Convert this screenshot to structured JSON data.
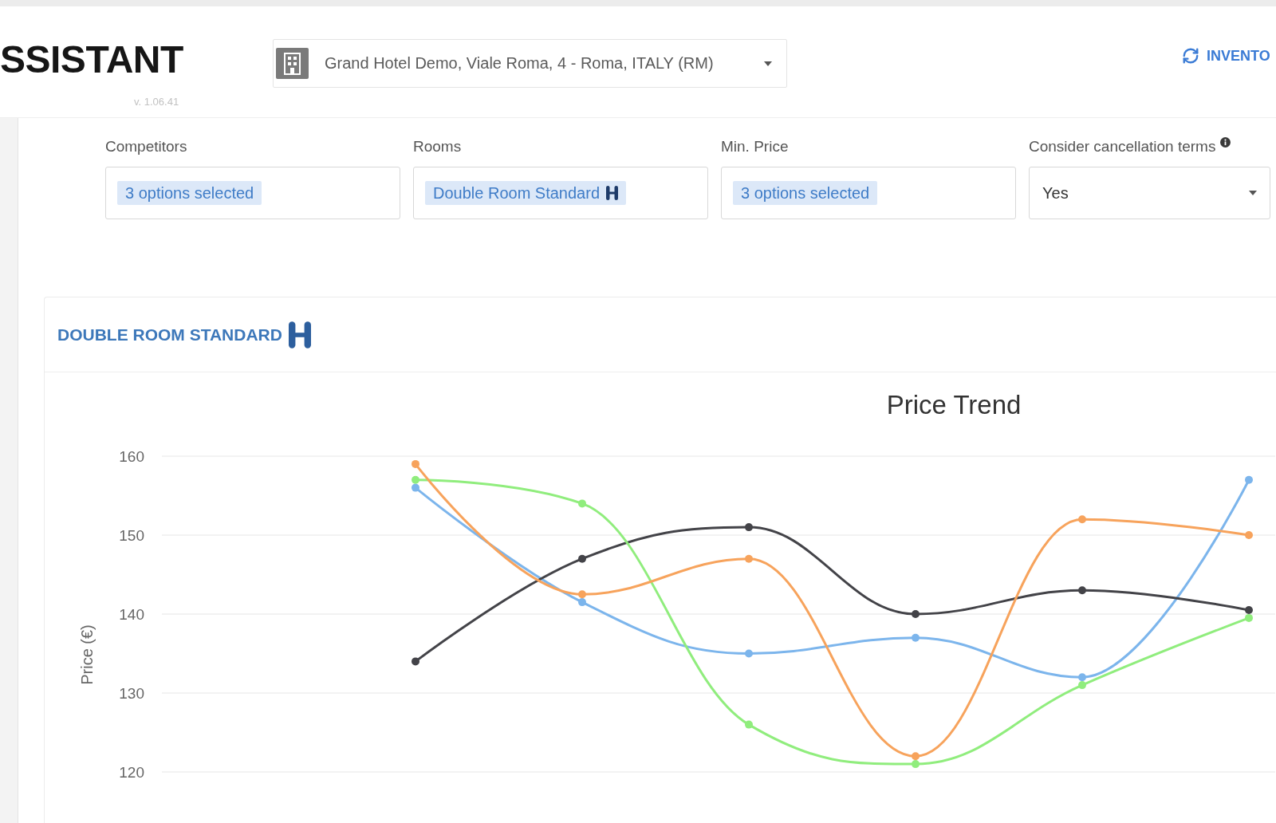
{
  "header": {
    "logo": "SSISTANT",
    "version": "v. 1.06.41",
    "hotel_select": {
      "value": "Grand Hotel Demo, Viale Roma, 4 - Roma, ITALY (RM)"
    },
    "link": "INVENTO"
  },
  "filters": [
    {
      "label": "Competitors",
      "kind": "multiselect",
      "info": false,
      "tag": {
        "text": "3 options selected",
        "kind": "text"
      }
    },
    {
      "label": "Rooms",
      "kind": "multiselect",
      "info": false,
      "tag": {
        "text": "Double Room Standard",
        "kind": "room"
      }
    },
    {
      "label": "Min. Price",
      "kind": "multiselect",
      "info": false,
      "tag": {
        "text": "3 options selected",
        "kind": "text"
      }
    },
    {
      "label": "Consider cancellation terms",
      "kind": "select",
      "info": true,
      "value": "Yes"
    }
  ],
  "section": {
    "title": "DOUBLE ROOM STANDARD",
    "chart_data": {
      "type": "line",
      "title": "Price Trend",
      "ylabel": "Price (€)",
      "ylim": [
        120,
        160
      ],
      "yticks": [
        120,
        130,
        140,
        150,
        160
      ],
      "grid": true,
      "series": [
        {
          "color": "#7cb5ec",
          "marker": "circle",
          "values": [
            156,
            141.5,
            135,
            137,
            132,
            157
          ]
        },
        {
          "color": "#434348",
          "marker": "circle",
          "values": [
            134,
            147,
            151,
            140,
            143,
            140.5
          ]
        },
        {
          "color": "#90ed7d",
          "marker": "circle",
          "values": [
            157,
            154,
            126,
            121,
            131,
            139.5
          ]
        },
        {
          "color": "#f7a35c",
          "marker": "circle",
          "values": [
            159,
            142.5,
            147,
            122,
            152,
            150
          ]
        }
      ]
    }
  }
}
